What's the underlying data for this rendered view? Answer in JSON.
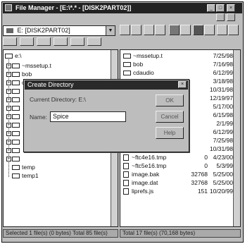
{
  "window": {
    "title": "File Manager - [E:\\*.* - [DISK2PART02]]"
  },
  "menu": {
    "items": [
      "File",
      "Disk",
      "Tree",
      "View",
      "Options",
      "Window",
      "Help"
    ]
  },
  "toolbar": {
    "drive_label": "E: [DISK2PART02]"
  },
  "left_pane": {
    "root": "e:\\",
    "folders": [
      "~mssetup.t",
      "bob",
      "cdaudio",
      "",
      "",
      "",
      "",
      "",
      "",
      "",
      "",
      "",
      "temp",
      "temp1"
    ]
  },
  "right_pane": {
    "files": [
      {
        "name": "~mssetup.t",
        "size": "",
        "date": "7/25/98",
        "kind": "folder"
      },
      {
        "name": "bob",
        "size": "",
        "date": "7/16/98",
        "kind": "folder"
      },
      {
        "name": "cdaudio",
        "size": "",
        "date": "6/12/99",
        "kind": "folder"
      },
      {
        "name": "",
        "size": "",
        "date": "3/18/98",
        "kind": "folder"
      },
      {
        "name": "",
        "size": "",
        "date": "10/31/98",
        "kind": "folder"
      },
      {
        "name": "",
        "size": "",
        "date": "12/19/97",
        "kind": "folder"
      },
      {
        "name": "",
        "size": "",
        "date": "5/17/00",
        "kind": "folder"
      },
      {
        "name": "",
        "size": "",
        "date": "6/15/98",
        "kind": "folder"
      },
      {
        "name": "",
        "size": "",
        "date": "2/1/99",
        "kind": "folder"
      },
      {
        "name": "",
        "size": "",
        "date": "6/12/99",
        "kind": "folder"
      },
      {
        "name": "",
        "size": "",
        "date": "7/25/98",
        "kind": "folder"
      },
      {
        "name": "temp1",
        "size": "",
        "date": "10/31/98",
        "kind": "folder"
      },
      {
        "name": "~ftc4e16.tmp",
        "size": "0",
        "date": "4/23/00",
        "kind": "file"
      },
      {
        "name": "~ftc5e16.tmp",
        "size": "0",
        "date": "5/3/99",
        "kind": "file"
      },
      {
        "name": "image.bak",
        "size": "32768",
        "date": "5/25/00",
        "kind": "file"
      },
      {
        "name": "image.dat",
        "size": "32768",
        "date": "5/25/00",
        "kind": "file"
      },
      {
        "name": "liprefs.js",
        "size": "151",
        "date": "10/20/99",
        "kind": "file"
      }
    ]
  },
  "status": {
    "left": "Selected 1 file(s) (0 bytes)  Total 85 file(s)",
    "right": "Total 17 file(s) (70,168 bytes)"
  },
  "dialog": {
    "title": "Create Directory",
    "current_dir": "Current Directory: E:\\",
    "name_label": "Name:",
    "name_value": "Spice",
    "ok": "OK",
    "cancel": "Cancel",
    "help": "Help"
  }
}
